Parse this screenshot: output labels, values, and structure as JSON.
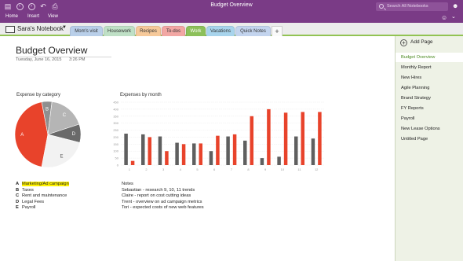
{
  "window": {
    "title": "Budget Overview",
    "search_placeholder": "Search All Notebooks"
  },
  "menu": [
    "Home",
    "Insert",
    "View"
  ],
  "notebook": {
    "name": "Sara's Notebook"
  },
  "tabs": [
    {
      "label": "Mom's visit",
      "color": "#b9cfe9",
      "active": false
    },
    {
      "label": "Housework",
      "color": "#bfe0c6",
      "active": false
    },
    {
      "label": "Recipes",
      "color": "#f6c99a",
      "active": false
    },
    {
      "label": "To-dos",
      "color": "#f2a7a4",
      "active": false
    },
    {
      "label": "Work",
      "color": "#8cc05a",
      "active": true
    },
    {
      "label": "Vacations",
      "color": "#a8d4ec",
      "active": false
    },
    {
      "label": "Quick Notes",
      "color": "#c3d4ee",
      "active": false
    }
  ],
  "add_tab_label": "+",
  "page": {
    "title": "Budget Overview",
    "date": "Tuesday, June 16, 2015",
    "time": "3:26 PM"
  },
  "pie": {
    "title": "Expense by category",
    "slices": [
      {
        "key": "A",
        "value": 44,
        "color": "#e8432b"
      },
      {
        "key": "B",
        "value": 5,
        "color": "#8f8f8f"
      },
      {
        "key": "C",
        "value": 18,
        "color": "#b5b5b5"
      },
      {
        "key": "D",
        "value": 9,
        "color": "#6a6a6a"
      },
      {
        "key": "E",
        "value": 24,
        "color": "#f2f2f2"
      }
    ]
  },
  "chart_data": {
    "type": "bar",
    "title": "Expenses by month",
    "categories": [
      "1",
      "2",
      "3",
      "4",
      "5",
      "6",
      "7",
      "8",
      "9",
      "10",
      "11",
      "12"
    ],
    "ylim": [
      0,
      450
    ],
    "yticks": [
      "0",
      "50",
      "100",
      "150",
      "200",
      "250",
      "300",
      "350",
      "400",
      "450"
    ],
    "series": [
      {
        "color": "#5f5f5f",
        "values": [
          225,
          220,
          205,
          160,
          155,
          100,
          205,
          175,
          50,
          60,
          205,
          190
        ]
      },
      {
        "color": "#e8432b",
        "values": [
          30,
          200,
          100,
          150,
          155,
          210,
          220,
          350,
          400,
          375,
          380,
          380
        ]
      }
    ]
  },
  "legend": [
    {
      "key": "A",
      "label": "Marketing/Ad campaign",
      "highlight": true
    },
    {
      "key": "B",
      "label": "Taxes",
      "highlight": false
    },
    {
      "key": "C",
      "label": "Rent and maintenance",
      "highlight": false
    },
    {
      "key": "D",
      "label": "Legal Fees",
      "highlight": false
    },
    {
      "key": "E",
      "label": "Payroll",
      "highlight": false
    }
  ],
  "notes": {
    "heading": "Notes",
    "lines": [
      "Sebastian - research 9, 10, 11 trends",
      "Claire - report on cost cutting ideas",
      "Trent - overview on ad campaign metrics",
      "Tori - expected costs of new web features"
    ]
  },
  "pages_pane": {
    "add_label": "Add Page",
    "items": [
      {
        "label": "Budget Overview",
        "selected": true
      },
      {
        "label": "Monthly Report",
        "selected": false
      },
      {
        "label": "New Hires",
        "selected": false
      },
      {
        "label": "Agile Planning",
        "selected": false
      },
      {
        "label": "Brand Strategy",
        "selected": false
      },
      {
        "label": "FY Reports",
        "selected": false
      },
      {
        "label": "Payroll",
        "selected": false
      },
      {
        "label": "New Lease Options",
        "selected": false
      },
      {
        "label": "Untitled Page",
        "selected": false
      }
    ]
  },
  "icons": [
    "notebooks-icon",
    "back-icon",
    "forward-icon",
    "undo-icon",
    "print-icon",
    "search-icon",
    "share-person-icon",
    "smiley-icon",
    "notebook-icon",
    "add-page-icon"
  ]
}
